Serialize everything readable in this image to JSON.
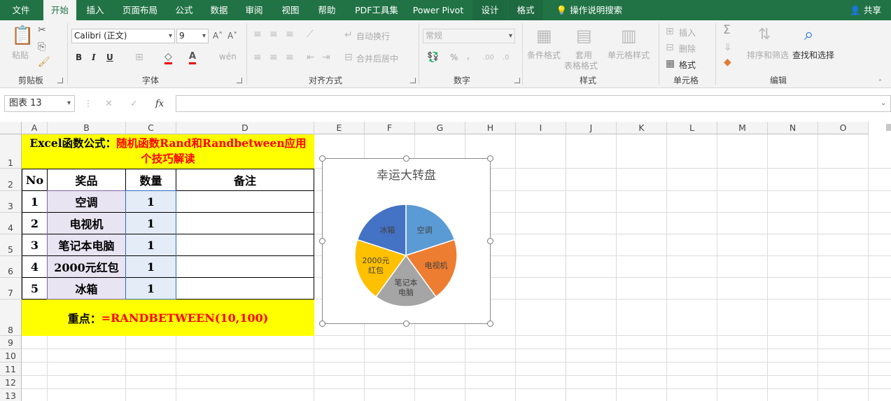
{
  "ribbon_tabs": [
    "文件",
    "开始",
    "插入",
    "页面布局",
    "公式",
    "数据",
    "审阅",
    "视图",
    "帮助",
    "PDF工具集",
    "Power Pivot",
    "设计",
    "格式"
  ],
  "active_tab": "开始",
  "tell_me": "操作说明搜索",
  "share": "共享",
  "clipboard": {
    "paste": "粘贴",
    "label": "剪贴板"
  },
  "font": {
    "name": "Calibri (正文)",
    "size": "9",
    "bold": "B",
    "italic": "I",
    "underline": "U",
    "label": "字体"
  },
  "alignment": {
    "wrap": "自动换行",
    "merge": "合并后居中",
    "label": "对齐方式"
  },
  "number": {
    "format": "常规",
    "percent": "%",
    "comma": ",",
    "label": "数字"
  },
  "styles": {
    "conditional": "条件格式",
    "table_line1": "套用",
    "table_line2": "表格格式",
    "cell_styles": "单元格样式",
    "label": "样式"
  },
  "cells": {
    "insert": "插入",
    "delete": "删除",
    "format": "格式",
    "label": "单元格"
  },
  "editing": {
    "sigma": "Σ",
    "sort_filter": "排序和筛选",
    "find_select": "查找和选择",
    "label": "编辑"
  },
  "formula_bar": {
    "name_box": "图表 13",
    "fx": "fx",
    "cancel": "✕",
    "enter": "✓"
  },
  "columns": [
    "A",
    "B",
    "C",
    "D",
    "E",
    "F",
    "G",
    "H",
    "I",
    "J",
    "K",
    "L",
    "M",
    "N",
    "O"
  ],
  "rows": [
    "1",
    "2",
    "3",
    "4",
    "5",
    "6",
    "7",
    "8",
    "9",
    "10",
    "11",
    "12",
    "13"
  ],
  "sheet": {
    "title_black": "Excel函数公式：",
    "title_red": "随机函数Rand和Randbetween应用个技巧解读",
    "headers": [
      "No",
      "奖品",
      "数量",
      "备注"
    ],
    "data": [
      [
        "1",
        "空调",
        "1",
        ""
      ],
      [
        "2",
        "电视机",
        "1",
        ""
      ],
      [
        "3",
        "笔记本电脑",
        "1",
        ""
      ],
      [
        "4",
        "2000元红包",
        "1",
        ""
      ],
      [
        "5",
        "冰箱",
        "1",
        ""
      ]
    ],
    "key_label": "重点：",
    "key_formula": "=RANDBETWEEN(10,100)"
  },
  "chart_data": {
    "type": "pie",
    "title": "幸运大转盘",
    "categories": [
      "空调",
      "电视机",
      "笔记本电脑",
      "2000元红包",
      "冰箱"
    ],
    "values": [
      1,
      1,
      1,
      1,
      1
    ],
    "colors": [
      "#5b9bd5",
      "#ed7d31",
      "#a5a5a5",
      "#ffc000",
      "#4472c4"
    ],
    "labels": [
      "空调",
      "电视机",
      "笔记本\n电脑",
      "2000元\n红包",
      "冰箱"
    ]
  },
  "colors": {
    "accent": "#217346",
    "highlight": "#ffff00",
    "red_text": "#ff0000"
  }
}
